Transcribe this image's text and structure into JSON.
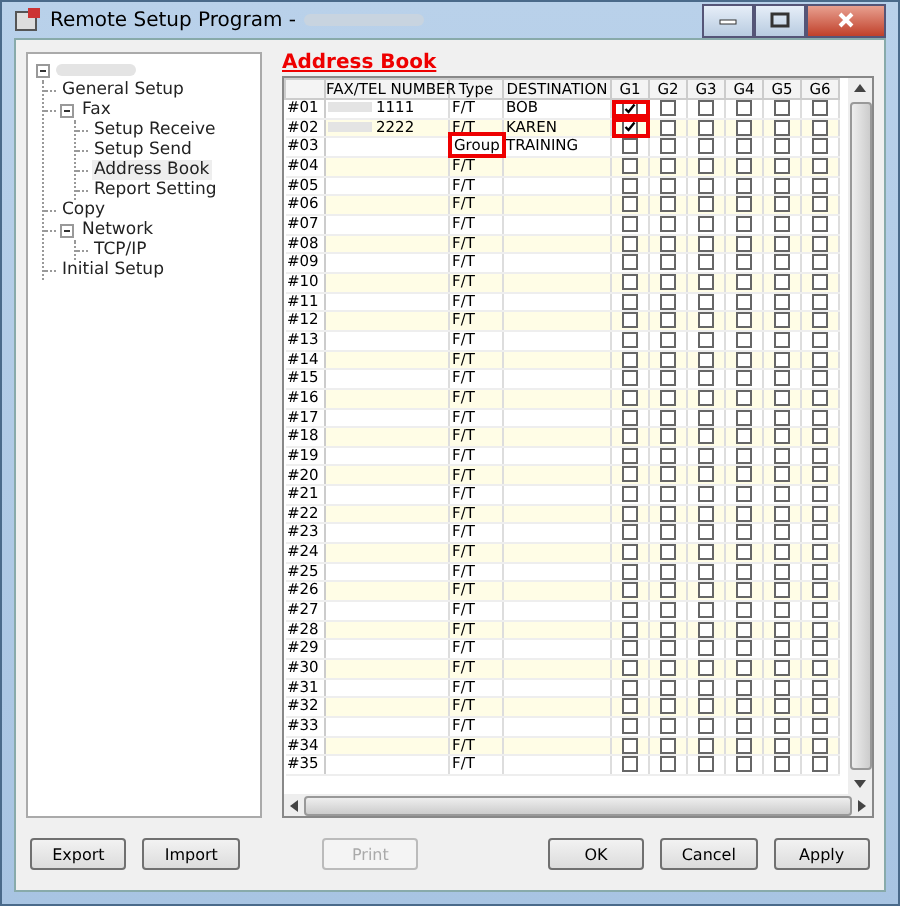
{
  "window": {
    "title": "Remote Setup Program -"
  },
  "tree": {
    "expanded": true,
    "children": [
      {
        "label": "General Setup"
      },
      {
        "label": "Fax",
        "expanded": true,
        "children": [
          {
            "label": "Setup Receive"
          },
          {
            "label": "Setup Send"
          },
          {
            "label": "Address Book",
            "selected": true
          },
          {
            "label": "Report Setting"
          }
        ]
      },
      {
        "label": "Copy"
      },
      {
        "label": "Network",
        "expanded": true,
        "children": [
          {
            "label": "TCP/IP"
          }
        ]
      },
      {
        "label": "Initial Setup"
      }
    ]
  },
  "section_title": "Address Book",
  "table": {
    "columns": [
      "FAX/TEL NUMBER",
      "Type",
      "DESTINATION",
      "G1",
      "G2",
      "G3",
      "G4",
      "G5",
      "G6"
    ],
    "rows": [
      {
        "no": "#01",
        "number": "1111",
        "type": "F/T",
        "destination": "BOB",
        "groups": [
          true,
          false,
          false,
          false,
          false,
          false
        ],
        "type_highlighted": false,
        "g1_highlighted": true
      },
      {
        "no": "#02",
        "number": "2222",
        "type": "F/T",
        "destination": "KAREN",
        "groups": [
          true,
          false,
          false,
          false,
          false,
          false
        ],
        "type_highlighted": false,
        "g1_highlighted": true
      },
      {
        "no": "#03",
        "type": "Group",
        "destination": "TRAINING",
        "groups": [
          false,
          false,
          false,
          false,
          false,
          false
        ],
        "type_highlighted": true,
        "g1_highlighted": false
      },
      {
        "no": "#04",
        "type": "F/T",
        "groups": [
          false,
          false,
          false,
          false,
          false,
          false
        ],
        "type_highlighted": false,
        "g1_highlighted": false
      },
      {
        "no": "#05",
        "type": "F/T",
        "groups": [
          false,
          false,
          false,
          false,
          false,
          false
        ],
        "type_highlighted": false,
        "g1_highlighted": false
      },
      {
        "no": "#06",
        "type": "F/T",
        "groups": [
          false,
          false,
          false,
          false,
          false,
          false
        ],
        "type_highlighted": false,
        "g1_highlighted": false
      },
      {
        "no": "#07",
        "type": "F/T",
        "groups": [
          false,
          false,
          false,
          false,
          false,
          false
        ],
        "type_highlighted": false,
        "g1_highlighted": false
      },
      {
        "no": "#08",
        "type": "F/T",
        "groups": [
          false,
          false,
          false,
          false,
          false,
          false
        ],
        "type_highlighted": false,
        "g1_highlighted": false
      },
      {
        "no": "#09",
        "type": "F/T",
        "groups": [
          false,
          false,
          false,
          false,
          false,
          false
        ],
        "type_highlighted": false,
        "g1_highlighted": false
      },
      {
        "no": "#10",
        "type": "F/T",
        "groups": [
          false,
          false,
          false,
          false,
          false,
          false
        ],
        "type_highlighted": false,
        "g1_highlighted": false
      },
      {
        "no": "#11",
        "type": "F/T",
        "groups": [
          false,
          false,
          false,
          false,
          false,
          false
        ],
        "type_highlighted": false,
        "g1_highlighted": false
      },
      {
        "no": "#12",
        "type": "F/T",
        "groups": [
          false,
          false,
          false,
          false,
          false,
          false
        ],
        "type_highlighted": false,
        "g1_highlighted": false
      },
      {
        "no": "#13",
        "type": "F/T",
        "groups": [
          false,
          false,
          false,
          false,
          false,
          false
        ],
        "type_highlighted": false,
        "g1_highlighted": false
      },
      {
        "no": "#14",
        "type": "F/T",
        "groups": [
          false,
          false,
          false,
          false,
          false,
          false
        ],
        "type_highlighted": false,
        "g1_highlighted": false
      },
      {
        "no": "#15",
        "type": "F/T",
        "groups": [
          false,
          false,
          false,
          false,
          false,
          false
        ],
        "type_highlighted": false,
        "g1_highlighted": false
      },
      {
        "no": "#16",
        "type": "F/T",
        "groups": [
          false,
          false,
          false,
          false,
          false,
          false
        ],
        "type_highlighted": false,
        "g1_highlighted": false
      },
      {
        "no": "#17",
        "type": "F/T",
        "groups": [
          false,
          false,
          false,
          false,
          false,
          false
        ],
        "type_highlighted": false,
        "g1_highlighted": false
      },
      {
        "no": "#18",
        "type": "F/T",
        "groups": [
          false,
          false,
          false,
          false,
          false,
          false
        ],
        "type_highlighted": false,
        "g1_highlighted": false
      },
      {
        "no": "#19",
        "type": "F/T",
        "groups": [
          false,
          false,
          false,
          false,
          false,
          false
        ],
        "type_highlighted": false,
        "g1_highlighted": false
      },
      {
        "no": "#20",
        "type": "F/T",
        "groups": [
          false,
          false,
          false,
          false,
          false,
          false
        ],
        "type_highlighted": false,
        "g1_highlighted": false
      },
      {
        "no": "#21",
        "type": "F/T",
        "groups": [
          false,
          false,
          false,
          false,
          false,
          false
        ],
        "type_highlighted": false,
        "g1_highlighted": false
      },
      {
        "no": "#22",
        "type": "F/T",
        "groups": [
          false,
          false,
          false,
          false,
          false,
          false
        ],
        "type_highlighted": false,
        "g1_highlighted": false
      },
      {
        "no": "#23",
        "type": "F/T",
        "groups": [
          false,
          false,
          false,
          false,
          false,
          false
        ],
        "type_highlighted": false,
        "g1_highlighted": false
      },
      {
        "no": "#24",
        "type": "F/T",
        "groups": [
          false,
          false,
          false,
          false,
          false,
          false
        ],
        "type_highlighted": false,
        "g1_highlighted": false
      },
      {
        "no": "#25",
        "type": "F/T",
        "groups": [
          false,
          false,
          false,
          false,
          false,
          false
        ],
        "type_highlighted": false,
        "g1_highlighted": false
      },
      {
        "no": "#26",
        "type": "F/T",
        "groups": [
          false,
          false,
          false,
          false,
          false,
          false
        ],
        "type_highlighted": false,
        "g1_highlighted": false
      },
      {
        "no": "#27",
        "type": "F/T",
        "groups": [
          false,
          false,
          false,
          false,
          false,
          false
        ],
        "type_highlighted": false,
        "g1_highlighted": false
      },
      {
        "no": "#28",
        "type": "F/T",
        "groups": [
          false,
          false,
          false,
          false,
          false,
          false
        ],
        "type_highlighted": false,
        "g1_highlighted": false
      },
      {
        "no": "#29",
        "type": "F/T",
        "groups": [
          false,
          false,
          false,
          false,
          false,
          false
        ],
        "type_highlighted": false,
        "g1_highlighted": false
      },
      {
        "no": "#30",
        "type": "F/T",
        "groups": [
          false,
          false,
          false,
          false,
          false,
          false
        ],
        "type_highlighted": false,
        "g1_highlighted": false
      },
      {
        "no": "#31",
        "type": "F/T",
        "groups": [
          false,
          false,
          false,
          false,
          false,
          false
        ],
        "type_highlighted": false,
        "g1_highlighted": false
      },
      {
        "no": "#32",
        "type": "F/T",
        "groups": [
          false,
          false,
          false,
          false,
          false,
          false
        ],
        "type_highlighted": false,
        "g1_highlighted": false
      },
      {
        "no": "#33",
        "type": "F/T",
        "groups": [
          false,
          false,
          false,
          false,
          false,
          false
        ],
        "type_highlighted": false,
        "g1_highlighted": false
      },
      {
        "no": "#34",
        "type": "F/T",
        "groups": [
          false,
          false,
          false,
          false,
          false,
          false
        ],
        "type_highlighted": false,
        "g1_highlighted": false
      },
      {
        "no": "#35",
        "type": "F/T",
        "groups": [
          false,
          false,
          false,
          false,
          false,
          false
        ],
        "type_highlighted": false,
        "g1_highlighted": false
      }
    ]
  },
  "buttons": [
    {
      "label": "Export",
      "disabled": false
    },
    {
      "label": "Import",
      "disabled": false
    },
    {
      "label": "Print",
      "disabled": true
    },
    {
      "label": "OK",
      "disabled": false
    },
    {
      "label": "Cancel",
      "disabled": false
    },
    {
      "label": "Apply",
      "disabled": false
    }
  ]
}
